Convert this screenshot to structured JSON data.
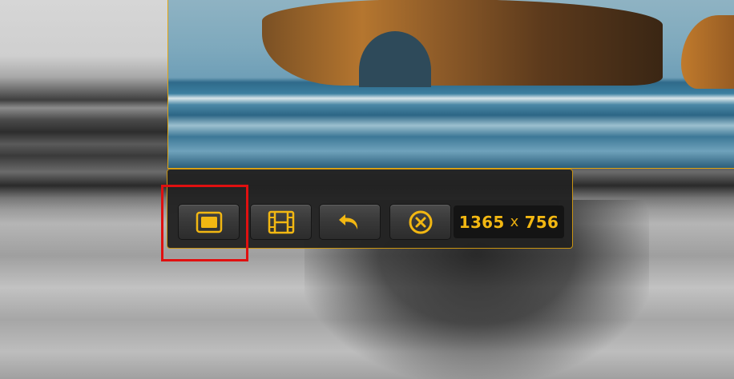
{
  "toolbar": {
    "buttons": [
      {
        "name": "fullscreen-capture-button",
        "icon": "screen-rectangle-icon"
      },
      {
        "name": "video-record-button",
        "icon": "film-strip-icon"
      },
      {
        "name": "undo-button",
        "icon": "undo-arrow-icon"
      },
      {
        "name": "cancel-button",
        "icon": "close-circle-icon"
      }
    ],
    "size": {
      "width": "1365",
      "separator": "x",
      "height": "756"
    }
  },
  "colors": {
    "accent": "#f2b712",
    "border": "#c99412",
    "highlight": "#e01010"
  }
}
